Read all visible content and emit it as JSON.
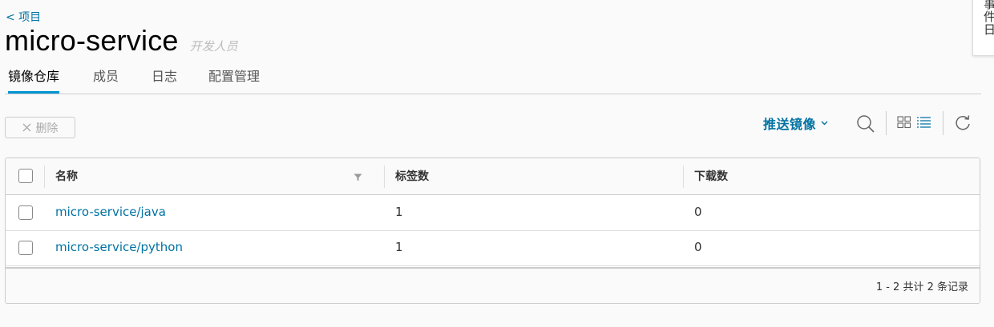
{
  "breadcrumb": {
    "back_label": "< 项目"
  },
  "header": {
    "title": "micro-service",
    "role": "开发人员"
  },
  "tabs": [
    {
      "label": "镜像仓库",
      "active": true
    },
    {
      "label": "成员",
      "active": false
    },
    {
      "label": "日志",
      "active": false
    },
    {
      "label": "配置管理",
      "active": false
    }
  ],
  "event_panel": {
    "label": "事件日"
  },
  "toolbar": {
    "delete_label": "删除",
    "push_label": "推送镜像",
    "icons": [
      "chevron-down-icon",
      "search-icon",
      "card-view-icon",
      "list-view-icon",
      "refresh-icon"
    ]
  },
  "table": {
    "columns": [
      "名称",
      "标签数",
      "下载数"
    ],
    "rows": [
      {
        "name": "micro-service/java",
        "tags": "1",
        "pulls": "0"
      },
      {
        "name": "micro-service/python",
        "tags": "1",
        "pulls": "0"
      }
    ],
    "footer": "1 - 2 共计 2 条记录"
  },
  "colors": {
    "link": "#0072a3",
    "tab_indicator": "#0094d2"
  }
}
